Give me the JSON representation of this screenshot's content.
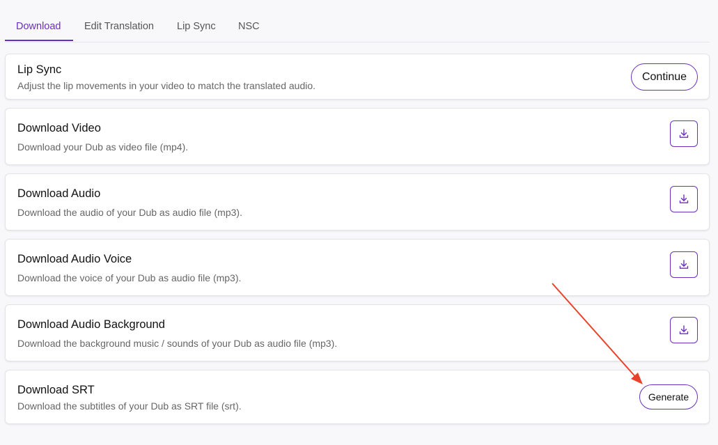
{
  "tabs": [
    {
      "label": "Download",
      "active": true
    },
    {
      "label": "Edit Translation",
      "active": false
    },
    {
      "label": "Lip Sync",
      "active": false
    },
    {
      "label": "NSC",
      "active": false
    }
  ],
  "lip_sync": {
    "title": "Lip Sync",
    "description": "Adjust the lip movements in your video to match the translated audio.",
    "button_label": "Continue"
  },
  "download_video": {
    "title": "Download Video",
    "description": "Download your Dub as video file (mp4).",
    "icon": "download-icon"
  },
  "download_audio": {
    "title": "Download Audio",
    "description": "Download the audio of your Dub as audio file (mp3).",
    "icon": "download-icon"
  },
  "download_audio_voice": {
    "title": "Download Audio Voice",
    "description": "Download the voice of your Dub as audio file (mp3).",
    "icon": "download-icon"
  },
  "download_audio_background": {
    "title": "Download Audio Background",
    "description": "Download the background music / sounds of your Dub as audio file (mp3).",
    "icon": "download-icon"
  },
  "download_srt": {
    "title": "Download SRT",
    "description": "Download the subtitles of your Dub as SRT file (srt).",
    "button_label": "Generate"
  },
  "colors": {
    "accent": "#6b2fc0",
    "annotation_arrow": "#e8432a"
  }
}
